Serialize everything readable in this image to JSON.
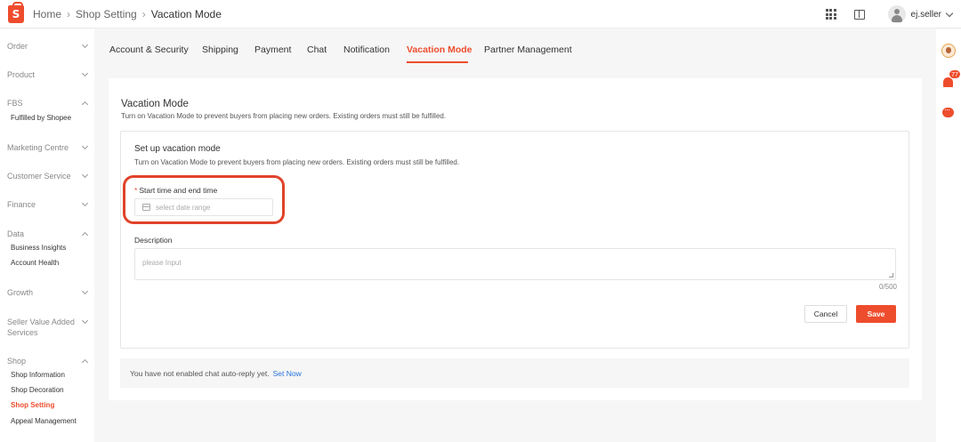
{
  "header": {
    "logo_letter": "S",
    "breadcrumb": [
      "Home",
      "Shop Setting",
      "Vacation Mode"
    ],
    "username": "ej.seller"
  },
  "sidebar": {
    "sections": [
      {
        "title": "Order",
        "expanded": false
      },
      {
        "title": "Product",
        "expanded": false
      },
      {
        "title": "FBS",
        "expanded": true,
        "items": [
          "Fulfilled by Shopee"
        ]
      },
      {
        "title": "Marketing Centre",
        "expanded": false
      },
      {
        "title": "Customer Service",
        "expanded": false
      },
      {
        "title": "Finance",
        "expanded": false
      },
      {
        "title": "Data",
        "expanded": true,
        "items": [
          "Business Insights",
          "Account Health"
        ]
      },
      {
        "title": "Growth",
        "expanded": false
      },
      {
        "title": "Seller Value Added Services",
        "expanded": false
      },
      {
        "title": "Shop",
        "expanded": true,
        "items": [
          "Shop Information",
          "Shop Decoration",
          "Shop Setting",
          "Appeal Management"
        ],
        "active_item": "Shop Setting"
      }
    ]
  },
  "tabs": [
    {
      "label": "Account & Security"
    },
    {
      "label": "Shipping"
    },
    {
      "label": "Payment"
    },
    {
      "label": "Chat"
    },
    {
      "label": "Notification"
    },
    {
      "label": "Vacation Mode",
      "active": true
    },
    {
      "label": "Partner Management"
    }
  ],
  "main": {
    "title": "Vacation Mode",
    "description": "Turn on Vacation Mode to prevent buyers from placing new orders. Existing orders must still be fulfilled.",
    "setup": {
      "title": "Set up vacation mode",
      "description": "Turn on Vacation Mode to prevent buyers from placing new orders. Existing orders must still be fulfilled.",
      "time_label_required_mark": "*",
      "time_label": "Start time and end time",
      "date_placeholder": "select date range",
      "description_label": "Description",
      "description_placeholder": "please Input",
      "char_counter": "0/500",
      "cancel_label": "Cancel",
      "save_label": "Save"
    },
    "notice": {
      "text": "You have not enabled chat auto-reply yet.",
      "link": "Set Now"
    }
  },
  "right_rail": {
    "notification_count": "77"
  },
  "colors": {
    "accent": "#ee4d2d",
    "highlight_ring": "#e0432a",
    "link": "#2673dd"
  },
  "icons": [
    "shopee-logo-icon",
    "apps-grid-icon",
    "book-icon",
    "user-avatar-icon",
    "chevron-down-icon",
    "calendar-icon",
    "bell-icon",
    "chat-icon"
  ]
}
